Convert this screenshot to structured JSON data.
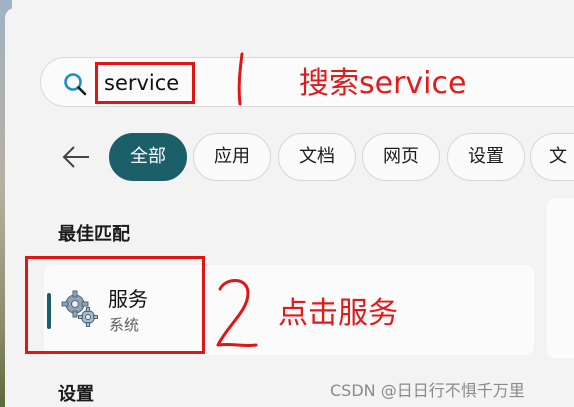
{
  "search": {
    "query": "service"
  },
  "annotations": {
    "note_search": "搜索service",
    "note_click": "点击服务"
  },
  "filters": {
    "tabs": [
      {
        "label": "全部",
        "active": true
      },
      {
        "label": "应用"
      },
      {
        "label": "文档"
      },
      {
        "label": "网页"
      },
      {
        "label": "设置"
      },
      {
        "label": "文"
      }
    ]
  },
  "best_match": {
    "title": "最佳匹配",
    "result": {
      "name": "服务",
      "category": "系统"
    }
  },
  "settings_section": {
    "title": "设置"
  },
  "watermark": "CSDN @日日行不惧千万里",
  "colors": {
    "accent": "#1b5f6b",
    "annotation": "#e01515"
  },
  "icons": {
    "search": "search-icon",
    "back": "back-arrow-icon",
    "app": "gears-icon"
  }
}
